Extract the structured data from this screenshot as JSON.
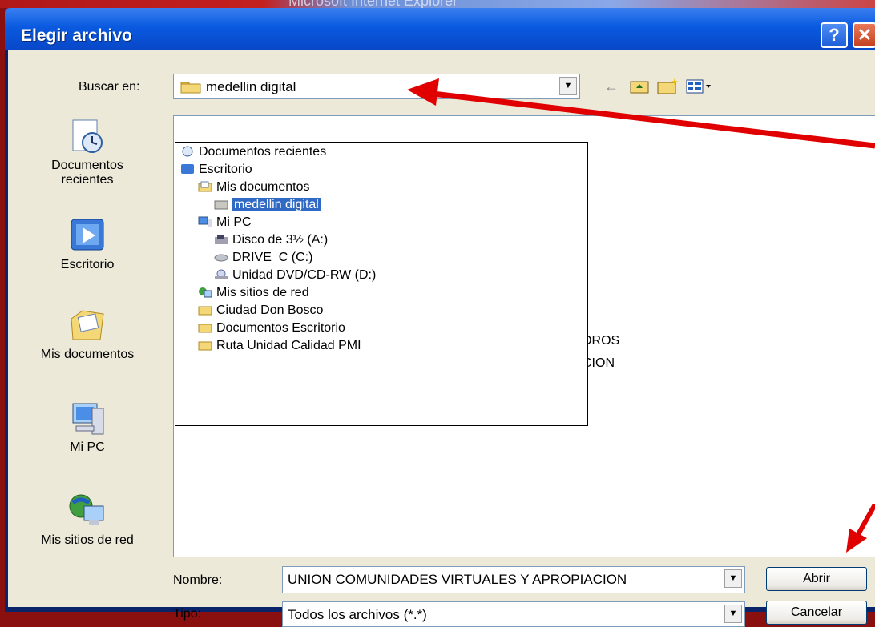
{
  "background_window": {
    "title": "Microsoft Internet Explorer"
  },
  "dialog": {
    "title": "Elegir archivo",
    "help_label": "?",
    "close_label": "✕"
  },
  "look_in": {
    "label": "Buscar en:",
    "value": "medellin digital"
  },
  "places_bar": [
    {
      "label": "Documentos recientes",
      "icon": "recent-documents-icon"
    },
    {
      "label": "Escritorio",
      "icon": "desktop-icon"
    },
    {
      "label": "Mis documentos",
      "icon": "my-documents-icon"
    },
    {
      "label": "Mi PC",
      "icon": "my-computer-icon"
    },
    {
      "label": "Mis sitios de red",
      "icon": "network-places-icon"
    }
  ],
  "dropdown_items": [
    {
      "label": "Documentos recientes",
      "icon": "recent-documents-icon"
    },
    {
      "label": "Escritorio",
      "icon": "desktop-icon"
    },
    {
      "label": "Mis documentos",
      "icon": "my-documents-icon"
    },
    {
      "label": "medellin digital",
      "icon": "folder-open-icon",
      "selected": true
    },
    {
      "label": "Mi PC",
      "icon": "my-computer-icon"
    },
    {
      "label": "Disco de 3½ (A:)",
      "icon": "floppy-drive-icon"
    },
    {
      "label": "DRIVE_C (C:)",
      "icon": "hard-drive-icon"
    },
    {
      "label": "Unidad DVD/CD-RW (D:)",
      "icon": "dvd-drive-icon"
    },
    {
      "label": "Mis sitios de red",
      "icon": "network-places-icon"
    },
    {
      "label": "Ciudad Don Bosco",
      "icon": "folder-icon"
    },
    {
      "label": "Documentos Escritorio",
      "icon": "folder-icon"
    },
    {
      "label": "Ruta Unidad Calidad PMI",
      "icon": "folder-icon"
    }
  ],
  "file_list_partial": [
    "DROS",
    "CION"
  ],
  "filename": {
    "label": "Nombre:",
    "value": "UNION COMUNIDADES VIRTUALES Y APROPIACION"
  },
  "filetype": {
    "label": "Tipo:",
    "value": "Todos los archivos (*.*)"
  },
  "buttons": {
    "open": "Abrir",
    "cancel": "Cancelar"
  },
  "colors": {
    "title_bar": "#0a5ae0",
    "selection": "#316ac5",
    "annotation_arrow": "#e00000"
  }
}
